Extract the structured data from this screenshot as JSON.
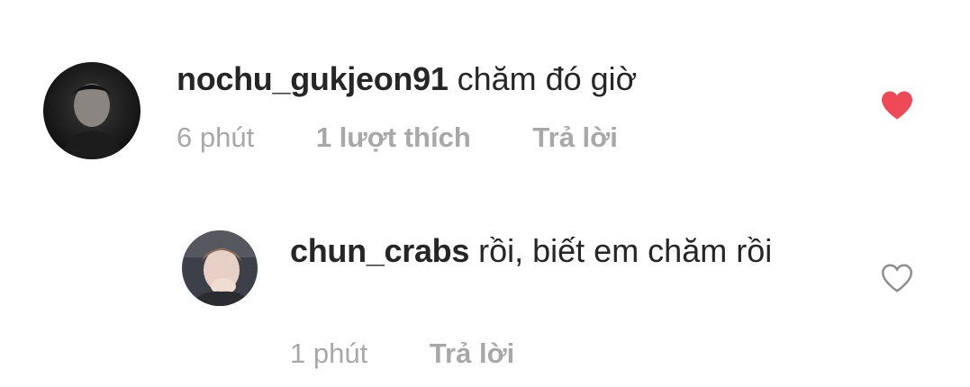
{
  "comments": [
    {
      "username": "nochu_gukjeon91",
      "text": "chăm đó giờ",
      "time": "6 phút",
      "likes": "1 lượt thích",
      "reply_label": "Trả lời",
      "liked": true,
      "avatar_icon": "user-avatar-dark"
    },
    {
      "username": "chun_crabs",
      "text": "rồi, biết em chăm rồi",
      "time": "1 phút",
      "reply_label": "Trả lời",
      "liked": false,
      "avatar_icon": "user-avatar-photo"
    }
  ],
  "colors": {
    "text": "#262626",
    "meta": "#a8a8a8",
    "like_active": "#ed4956",
    "like_inactive": "#8e8e8e"
  }
}
